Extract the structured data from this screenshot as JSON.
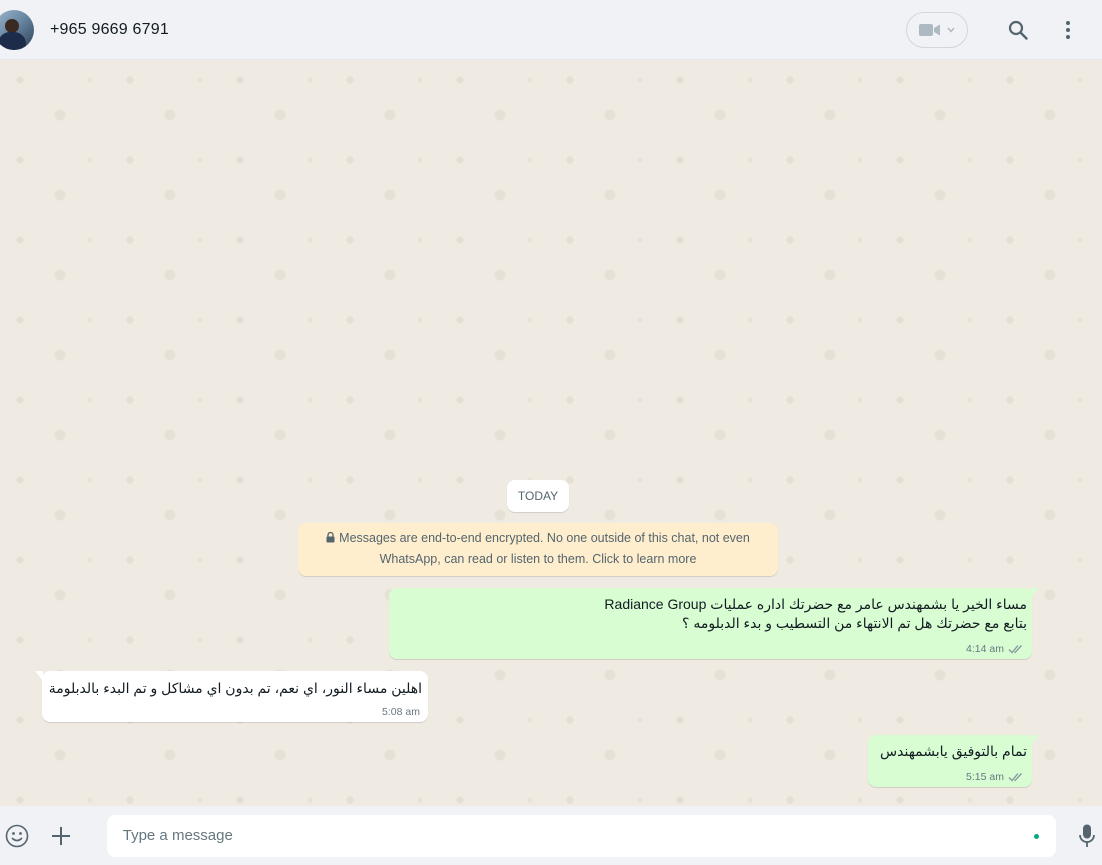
{
  "header": {
    "contact_name": "+965 9669 6791"
  },
  "chat": {
    "date_label": "TODAY",
    "encryption_notice": {
      "line1": "Messages are end-to-end encrypted. No one outside of this chat, not even",
      "line2": "WhatsApp, can read or listen to them. Click to learn more"
    },
    "messages": [
      {
        "direction": "outgoing",
        "line1": "مساء الخير يا بشمهندس عامر مع  حضرتك اداره عمليات Radiance Group",
        "line2": "بتابع مع حضرتك هل تم الانتهاء من التسطيب و بدء الدبلومه ؟",
        "time": "4:14 am",
        "status": "read"
      },
      {
        "direction": "incoming",
        "text": "اهلين مساء النور، اي نعم، تم بدون اي مشاكل و تم البدء بالدبلومة",
        "time": "5:08 am"
      },
      {
        "direction": "outgoing",
        "text": "تمام بالتوفيق يابشمهندس",
        "time": "5:15 am",
        "status": "read"
      }
    ]
  },
  "composer": {
    "placeholder": "Type a message"
  },
  "colors": {
    "outgoing_bubble": "#d9fdd3",
    "incoming_bubble": "#ffffff",
    "encryption_bg": "#ffeecd",
    "accent": "#00a884",
    "read_ticks": "#8696a0"
  }
}
